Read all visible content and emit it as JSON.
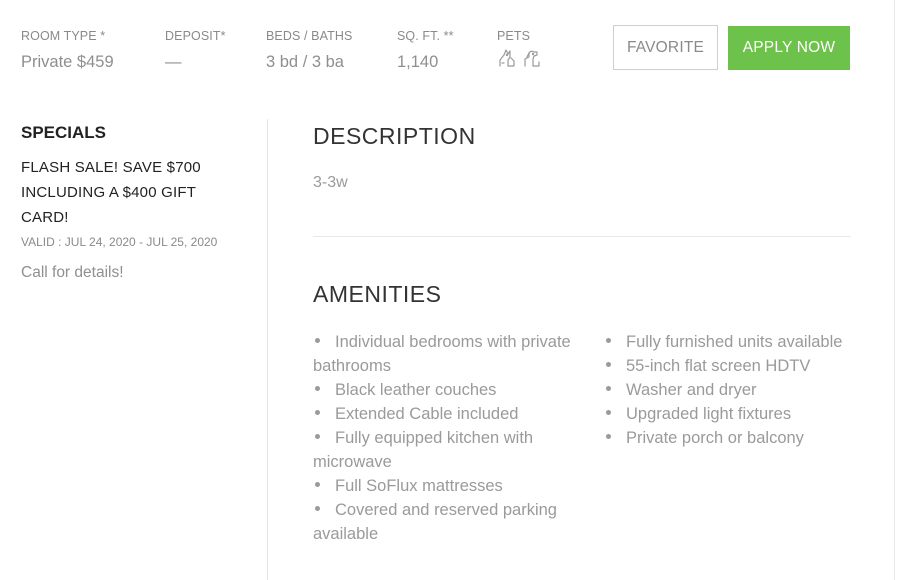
{
  "stats": {
    "room_type": {
      "label": "ROOM TYPE *",
      "value": "Private $459"
    },
    "deposit": {
      "label": "DEPOSIT*",
      "value": "—"
    },
    "beds_baths": {
      "label": "BEDS / BATHS",
      "value": "3 bd / 3 ba"
    },
    "sqft": {
      "label": "SQ. FT. **",
      "value": "1,140"
    },
    "pets": {
      "label": "PETS",
      "icons": [
        "cat-icon",
        "dog-icon"
      ]
    }
  },
  "actions": {
    "favorite_label": "FAVORITE",
    "apply_label": "APPLY NOW"
  },
  "colors": {
    "apply_button": "#6cc24a",
    "heading_text": "#222222",
    "muted_text": "#8f8f8f"
  },
  "specials": {
    "heading": "SPECIALS",
    "title": "FLASH SALE! SAVE $700 INCLUDING A $400 GIFT CARD!",
    "valid": "VALID : JUL 24, 2020 - JUL 25, 2020",
    "note": "Call for details!"
  },
  "description": {
    "heading": "DESCRIPTION",
    "text": "3-3w"
  },
  "amenities": {
    "heading": "AMENITIES",
    "column1": [
      "Individual bedrooms with private bathrooms",
      "Black leather couches",
      "Extended Cable included",
      "Fully equipped kitchen with microwave",
      "Full SoFlux mattresses",
      "Covered and reserved parking available"
    ],
    "column2": [
      "Fully furnished units available",
      "55-inch flat screen HDTV",
      "Washer and dryer",
      "Upgraded light fixtures",
      "Private porch or balcony"
    ]
  }
}
